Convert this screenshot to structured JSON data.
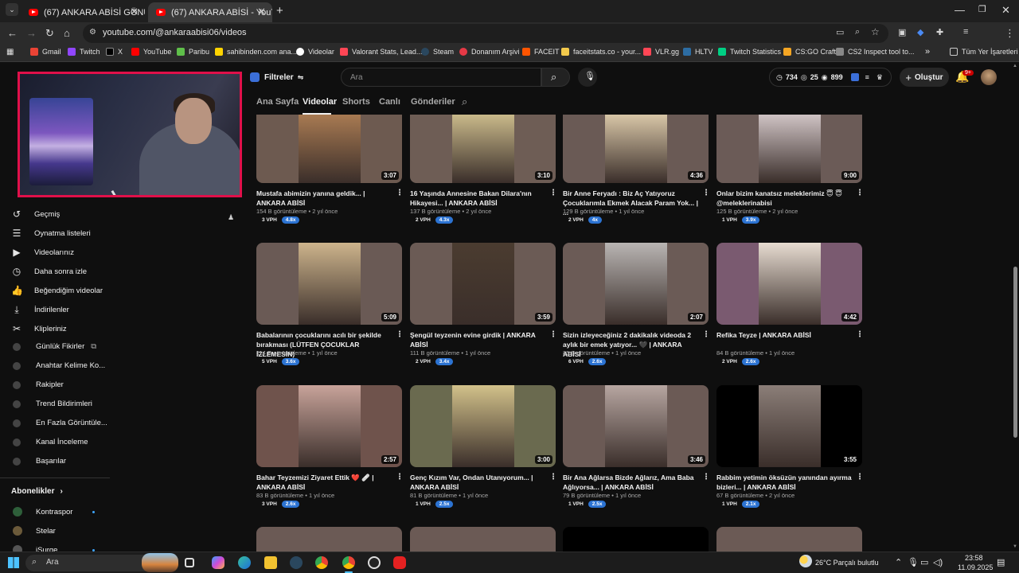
{
  "browser": {
    "tabs": [
      {
        "title": "(67) ANKARA ABİSİ GÖNÜL ZİY..."
      },
      {
        "title": "(67) ANKARA ABİSİ - YouTube"
      }
    ],
    "url": "youtube.com/@ankaraabisi06/videos",
    "bookmarks": [
      {
        "label": "Gmail",
        "color": "#ea4335"
      },
      {
        "label": "Twitch",
        "color": "#9146ff"
      },
      {
        "label": "X",
        "color": "#000000"
      },
      {
        "label": "YouTube",
        "color": "#ff0000"
      },
      {
        "label": "Paribu",
        "color": "#5fbf4a"
      },
      {
        "label": "sahibinden.com ana...",
        "color": "#ffd400"
      },
      {
        "label": "Videolar",
        "color": "#ffffff"
      },
      {
        "label": "Valorant Stats, Lead...",
        "color": "#ff4655"
      },
      {
        "label": "Steam",
        "color": "#1b2838"
      },
      {
        "label": "Donanım Arşivi",
        "color": "#e63946"
      },
      {
        "label": "FACEIT",
        "color": "#ff5500"
      },
      {
        "label": "faceitstats.co - your...",
        "color": "#f2c94c"
      },
      {
        "label": "VLR.gg",
        "color": "#ff4655"
      },
      {
        "label": "HLTV",
        "color": "#2d6da3"
      },
      {
        "label": "Twitch Statistics",
        "color": "#00d084"
      },
      {
        "label": "CS:GO Craft",
        "color": "#f5a623"
      },
      {
        "label": "CS2 Inspect tool to...",
        "color": "#888888"
      }
    ],
    "bookmarks_overflow": "»",
    "all_bookmarks": "Tüm Yer İşaretleri"
  },
  "youtube": {
    "filters_label": "Filtreler",
    "search_placeholder": "Ara",
    "stats": {
      "a": "734",
      "b": "25",
      "c": "899"
    },
    "create_label": "Oluştur",
    "notif_count": "9+",
    "channel_tabs": [
      "Ana Sayfa",
      "Videolar",
      "Shorts",
      "Canlı",
      "Gönderiler"
    ]
  },
  "sidebar": {
    "items": [
      {
        "label": "Geçmiş",
        "icon": "history-icon",
        "glyph": "↺"
      },
      {
        "label": "Oynatma listeleri",
        "icon": "playlist-icon",
        "glyph": "☰"
      },
      {
        "label": "Videolarınız",
        "icon": "your-videos-icon",
        "glyph": "▶"
      },
      {
        "label": "Daha sonra izle",
        "icon": "watch-later-icon",
        "glyph": "◷"
      },
      {
        "label": "Beğendiğim videolar",
        "icon": "like-icon",
        "glyph": "👍"
      },
      {
        "label": "İndirilenler",
        "icon": "download-icon",
        "glyph": "⤓"
      },
      {
        "label": "Klipleriniz",
        "icon": "clips-icon",
        "glyph": "✂"
      }
    ],
    "ext_items": [
      {
        "label": "Günlük Fikirler",
        "external": "⧉"
      },
      {
        "label": "Anahtar Kelime Ko...",
        "external": ""
      },
      {
        "label": "Rakipler",
        "external": ""
      },
      {
        "label": "Trend Bildirimleri",
        "external": ""
      },
      {
        "label": "En Fazla Görüntüle...",
        "external": ""
      },
      {
        "label": "Kanal İnceleme",
        "external": ""
      },
      {
        "label": "Başarılar",
        "external": ""
      }
    ],
    "subs_heading": "Abonelikler",
    "subs": [
      {
        "label": "Kontraspor",
        "dot": true
      },
      {
        "label": "Stelar",
        "dot": false
      },
      {
        "label": "iSurge",
        "dot": true
      }
    ]
  },
  "videos": [
    {
      "title": "Mustafa abimizin yanına geldik... | ANKARA ABİSİ",
      "views": "154 B görüntüleme",
      "age": "2 yıl önce",
      "duration": "3:07",
      "vph": "3 VPH",
      "mult": "4.8x"
    },
    {
      "title": "16 Yaşında Annesine Bakan Dilara'nın Hikayesi... | ANKARA ABİSİ",
      "views": "137 B görüntüleme",
      "age": "2 yıl önce",
      "duration": "3:10",
      "vph": "2 VPH",
      "mult": "4.3x"
    },
    {
      "title": "Bir Anne Feryadı : Biz Aç Yatıyoruz Çocuklarımla Ekmek Alacak Param Yok... | ...",
      "views": "129 B görüntüleme",
      "age": "1 yıl önce",
      "duration": "4:36",
      "vph": "2 VPH",
      "mult": "4x"
    },
    {
      "title": "Onlar bizim kanatsız meleklerimiz 😇 😇 @meleklerinabisi",
      "views": "125 B görüntüleme",
      "age": "2 yıl önce",
      "duration": "9:00",
      "vph": "1 VPH",
      "mult": "3.9x"
    },
    {
      "title": "Babalarının çocuklarını acılı bir şekilde bırakması (LÜTFEN ÇOCUKLAR İZLEMESİN)",
      "views": "114 B görüntüleme",
      "age": "1 yıl önce",
      "duration": "5:09",
      "vph": "5 VPH",
      "mult": "3.6x"
    },
    {
      "title": "Şengül teyzenin evine girdik | ANKARA ABİSİ",
      "views": "111 B görüntüleme",
      "age": "1 yıl önce",
      "duration": "3:59",
      "vph": "2 VPH",
      "mult": "3.4x"
    },
    {
      "title": "Sizin izleyeceğiniz 2 dakikalık videoda 2 aylık bir emek yatıyor... 🖤 | ANKARA ABİSİ",
      "views": "85 B görüntüleme",
      "age": "1 yıl önce",
      "duration": "2:07",
      "vph": "6 VPH",
      "mult": "2.6x"
    },
    {
      "title": "Refika Teyze | ANKARA ABİSİ",
      "views": "84 B görüntüleme",
      "age": "1 yıl önce",
      "duration": "4:42",
      "vph": "2 VPH",
      "mult": "2.6x"
    },
    {
      "title": "Bahar Teyzemizi Ziyaret Ettik ❤️ 🩹 | ANKARA ABİSİ",
      "views": "83 B görüntüleme",
      "age": "1 yıl önce",
      "duration": "2:57",
      "vph": "3 VPH",
      "mult": "2.6x"
    },
    {
      "title": "Genç Kızım Var, Ondan Utanıyorum... | ANKARA ABİSİ",
      "views": "81 B görüntüleme",
      "age": "1 yıl önce",
      "duration": "3:00",
      "vph": "1 VPH",
      "mult": "2.5x"
    },
    {
      "title": "Bir Ana Ağlarsa Bizde Ağlarız, Ama Baba Ağlıyorsa... | ANKARA ABİSİ",
      "views": "79 B görüntüleme",
      "age": "1 yıl önce",
      "duration": "3:46",
      "vph": "1 VPH",
      "mult": "2.5x"
    },
    {
      "title": "Rabbim yetimin öksüzün yanından ayırma bizleri... | ANKARA ABİSİ",
      "views": "67 B görüntüleme",
      "age": "2 yıl önce",
      "duration": "3:55",
      "vph": "1 VPH",
      "mult": "2.1x"
    }
  ],
  "taskbar": {
    "search": "Ara",
    "weather": "26°C  Parçalı bulutlu",
    "time": "23:58",
    "date": "11.09.2025"
  }
}
